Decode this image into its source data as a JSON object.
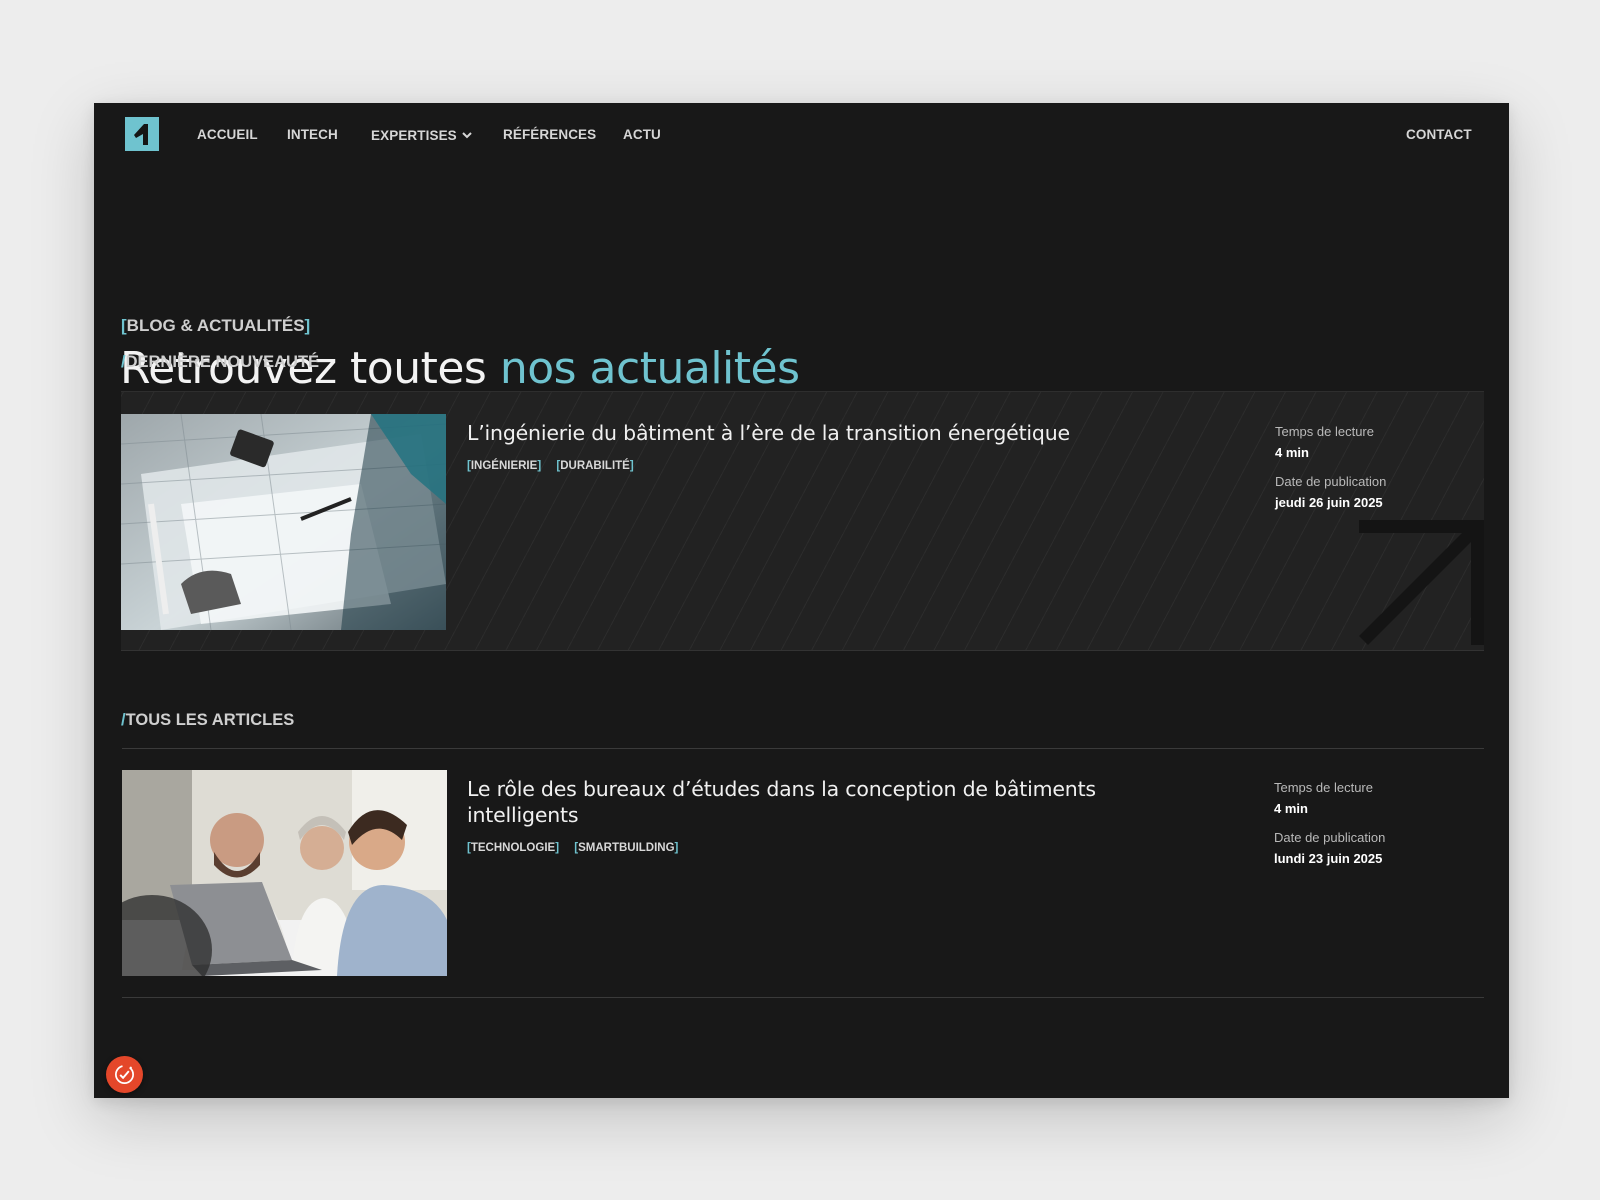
{
  "nav": {
    "items": [
      {
        "label": "ACCUEIL"
      },
      {
        "label": "INTECH"
      },
      {
        "label": "EXPERTISES"
      },
      {
        "label": "RÉFÉRENCES"
      },
      {
        "label": "ACTU"
      }
    ],
    "contact": "CONTACT"
  },
  "header": {
    "eyebrow_open": "[",
    "eyebrow": "BLOG & ACTUALITÉS",
    "eyebrow_close": "]",
    "title_main": "Retrouvez toutes ",
    "title_accent": "nos actualités"
  },
  "featured": {
    "section_slash": "/",
    "section_label": "DERNIÈRE NOUVEAUTÉ",
    "title": "L’ingénierie du bâtiment à l’ère de la transition énergétique",
    "tags": [
      "INGÉNIERIE",
      "DURABILITÉ"
    ],
    "reading_label": "Temps de lecture",
    "reading_value": "4 min",
    "date_label": "Date de publication",
    "date_value": "jeudi 26 juin 2025"
  },
  "articles": {
    "section_slash": "/",
    "section_label": "TOUS LES ARTICLES",
    "items": [
      {
        "title": "Le rôle des bureaux d’études dans la conception de bâtiments intelligents",
        "tags": [
          "TECHNOLOGIE",
          "SMARTBUILDING"
        ],
        "reading_label": "Temps de lecture",
        "reading_value": "4 min",
        "date_label": "Date de publication",
        "date_value": "lundi 23 juin 2025"
      }
    ]
  },
  "colors": {
    "accent": "#6fc3cf",
    "background": "#181818",
    "cookie": "#e4472a"
  },
  "icons": {
    "logo": "brand-logo-icon",
    "expertises_chevron": "chevron-down-icon",
    "arrow": "arrow-up-right-icon",
    "cookie": "cookie-consent-icon"
  }
}
